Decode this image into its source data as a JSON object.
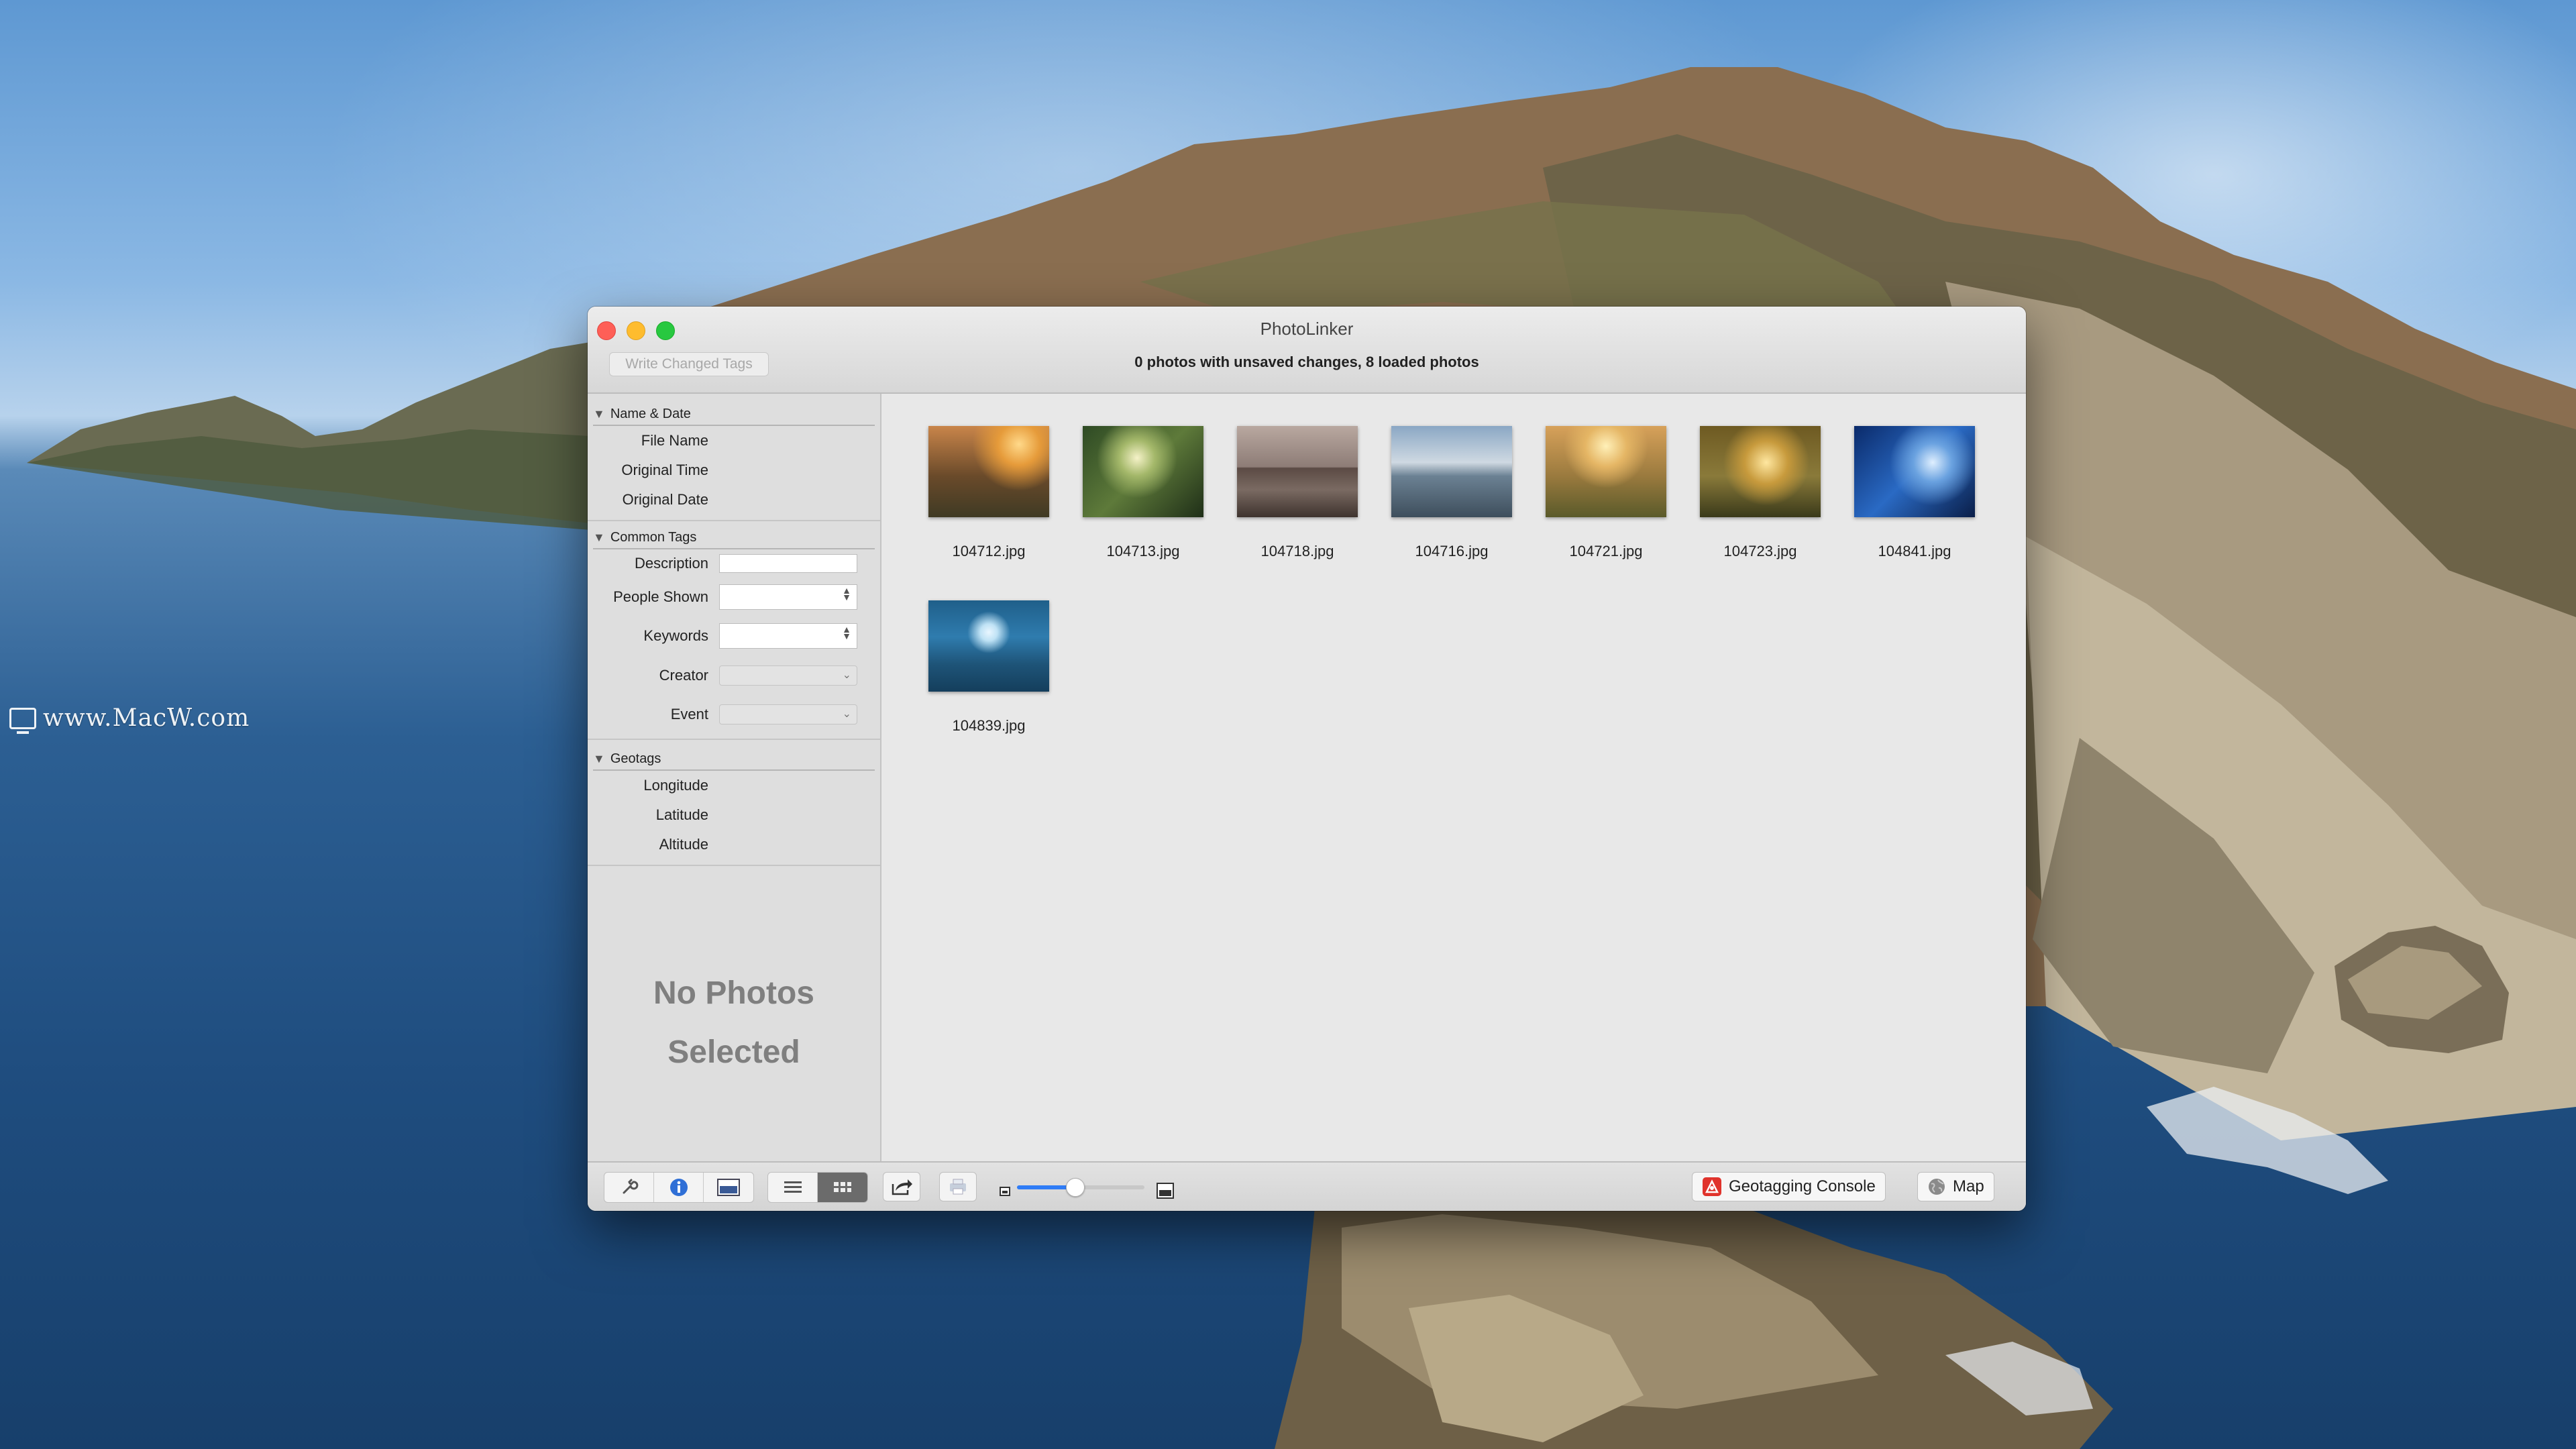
{
  "watermark": "www.MacW.com",
  "window": {
    "title": "PhotoLinker",
    "write_button": "Write Changed Tags",
    "status": "0 photos with unsaved changes, 8 loaded photos"
  },
  "sidebar": {
    "sections": [
      {
        "title": "Name & Date",
        "fields": [
          "File Name",
          "Original Time",
          "Original Date"
        ]
      },
      {
        "title": "Common Tags",
        "fields": [
          "Description",
          "People Shown",
          "Keywords",
          "Creator",
          "Event"
        ]
      },
      {
        "title": "Geotags",
        "fields": [
          "Longitude",
          "Latitude",
          "Altitude"
        ]
      }
    ],
    "empty_line1": "No Photos",
    "empty_line2": "Selected"
  },
  "photos": [
    {
      "name": "104712.jpg",
      "palette": "sunset-girl"
    },
    {
      "name": "104713.jpg",
      "palette": "forest-green"
    },
    {
      "name": "104718.jpg",
      "palette": "rail-track"
    },
    {
      "name": "104716.jpg",
      "palette": "seaside-child"
    },
    {
      "name": "104721.jpg",
      "palette": "field-couple"
    },
    {
      "name": "104723.jpg",
      "palette": "golden-park"
    },
    {
      "name": "104841.jpg",
      "palette": "blue-wave"
    },
    {
      "name": "104839.jpg",
      "palette": "ocean-surf"
    }
  ],
  "toolbar": {
    "geotagging_console": "Geotagging Console",
    "map": "Map",
    "thumbnail_size": 0.45
  },
  "colors": {
    "accent": "#2f7cf6",
    "geotag_icon": "#e0332c"
  }
}
